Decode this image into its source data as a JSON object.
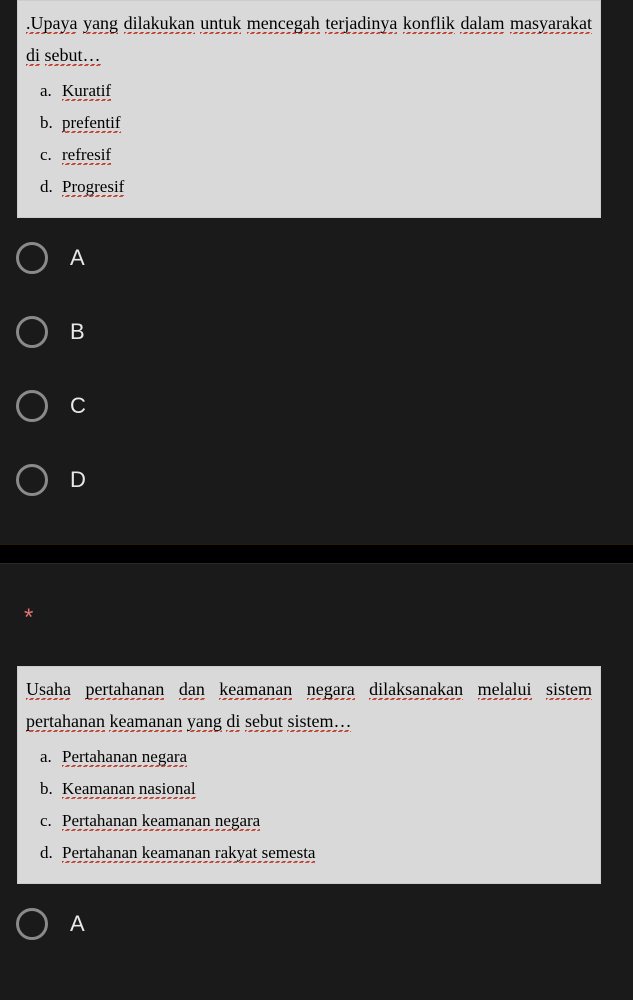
{
  "required_marker": "*",
  "questions": [
    {
      "stem": ".Upaya yang dilakukan untuk mencegah terjadinya konflik dalam masyarakat di sebut…",
      "stem_words": [
        ".Upaya",
        "yang",
        "dilakukan",
        "untuk",
        "mencegah",
        "terjadinya",
        "konflik",
        "dalam",
        "masyarakat",
        "di",
        "sebut…"
      ],
      "justify": true,
      "choices": [
        {
          "letter": "a.",
          "text": "Kuratif"
        },
        {
          "letter": "b.",
          "text": "prefentif"
        },
        {
          "letter": "c.",
          "text": "refresif"
        },
        {
          "letter": "d.",
          "text": "Progresif"
        }
      ],
      "option_labels": [
        "A",
        "B",
        "C",
        "D"
      ]
    },
    {
      "stem": "Usaha pertahanan dan keamanan  negara dilaksanakan melalui sistem pertahanan keamanan yang di sebut sistem…",
      "stem_words": [
        "Usaha",
        "pertahanan",
        "dan",
        "keamanan",
        " negara",
        "dilaksanakan",
        "melalui",
        "sistem",
        "pertahanan",
        "keamanan",
        "yang",
        "di",
        "sebut",
        "sistem…"
      ],
      "justify": true,
      "choices": [
        {
          "letter": "a.",
          "text": "Pertahanan negara"
        },
        {
          "letter": "b.",
          "text": "Keamanan nasional"
        },
        {
          "letter": "c.",
          "text": "Pertahanan keamanan negara"
        },
        {
          "letter": "d.",
          "text": "Pertahanan keamanan rakyat semesta"
        }
      ],
      "option_labels": [
        "A"
      ]
    }
  ]
}
